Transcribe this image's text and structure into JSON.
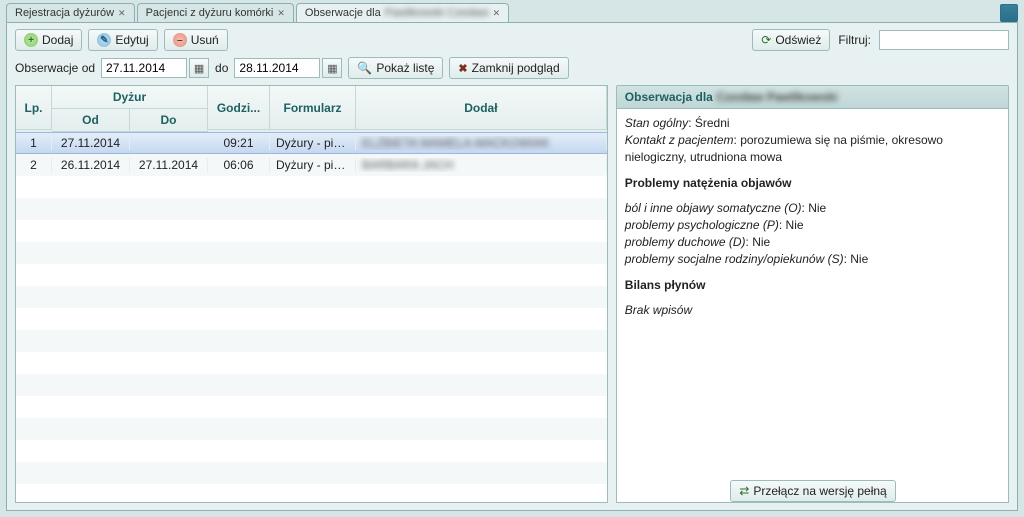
{
  "tabs": [
    {
      "label": "Rejestracja dyżurów"
    },
    {
      "label": "Pacjenci z dyżuru komórki"
    },
    {
      "label_prefix": "Obserwacje dla",
      "label_name": "Pawlikowski Czesław"
    }
  ],
  "toolbar": {
    "add": "Dodaj",
    "edit": "Edytuj",
    "delete": "Usuń"
  },
  "filter": {
    "from_label": "Obserwacje od",
    "from_value": "27.11.2014",
    "to_label": "do",
    "to_value": "28.11.2014",
    "show_list": "Pokaż listę",
    "close_preview": "Zamknij podgląd",
    "refresh": "Odśwież",
    "filter_label": "Filtruj:",
    "filter_value": ""
  },
  "grid": {
    "headers": {
      "lp": "Lp.",
      "duty": "Dyżur",
      "od": "Od",
      "do": "Do",
      "time": "Godzi...",
      "form": "Formularz",
      "added_by": "Dodał"
    },
    "rows": [
      {
        "lp": "1",
        "od": "27.11.2014",
        "do": "",
        "time": "09:21",
        "form": "Dyżury - pielęgn",
        "added_by": "ELŻBIETA MAMELA-MAĆKOWIAK",
        "selected": true
      },
      {
        "lp": "2",
        "od": "26.11.2014",
        "do": "27.11.2014",
        "time": "06:06",
        "form": "Dyżury - pielęgn",
        "added_by": "BARBARA JACH",
        "selected": false
      }
    ]
  },
  "detail": {
    "header_prefix": "Obserwacja dla",
    "header_name": "Czesław Pawlikowski",
    "lines": {
      "stan_label": "Stan ogólny",
      "stan_value": "Średni",
      "kontakt_label": "Kontakt z pacjentem",
      "kontakt_value": "porozumiewa się na piśmie, okresowo nielogiczny, utrudniona mowa",
      "sec_problems": "Problemy natężenia objawów",
      "bol_label": "ból i inne objawy somatyczne (O)",
      "bol_value": "Nie",
      "psych_label": "problemy psychologiczne (P)",
      "psych_value": "Nie",
      "duch_label": "problemy duchowe (D)",
      "duch_value": "Nie",
      "soc_label": "problemy socjalne rodziny/opiekunów (S)",
      "soc_value": "Nie",
      "sec_bilans": "Bilans płynów",
      "bilans_empty": "Brak wpisów"
    }
  },
  "bottom": {
    "switch_full": "Przełącz na wersję pełną"
  }
}
